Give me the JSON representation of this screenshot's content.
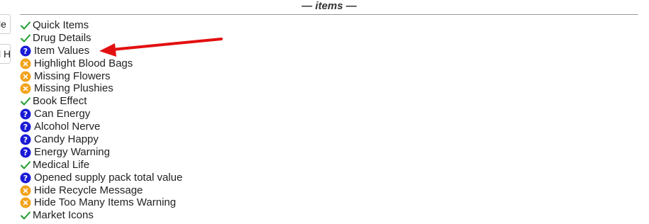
{
  "left_panel": {
    "fragment_1": "le",
    "fragment_2": "l H"
  },
  "section": {
    "title": "— items —"
  },
  "items": [
    {
      "label": "Quick Items",
      "status": "enabled",
      "icon": "check-icon"
    },
    {
      "label": "Drug Details",
      "status": "enabled",
      "icon": "check-icon"
    },
    {
      "label": "Item Values",
      "status": "unknown",
      "icon": "question-icon"
    },
    {
      "label": "Highlight Blood Bags",
      "status": "disabled",
      "icon": "x-circle-icon"
    },
    {
      "label": "Missing Flowers",
      "status": "disabled",
      "icon": "x-circle-icon"
    },
    {
      "label": "Missing Plushies",
      "status": "disabled",
      "icon": "x-circle-icon"
    },
    {
      "label": "Book Effect",
      "status": "enabled",
      "icon": "check-icon"
    },
    {
      "label": "Can Energy",
      "status": "unknown",
      "icon": "question-icon"
    },
    {
      "label": "Alcohol Nerve",
      "status": "unknown",
      "icon": "question-icon"
    },
    {
      "label": "Candy Happy",
      "status": "unknown",
      "icon": "question-icon"
    },
    {
      "label": "Energy Warning",
      "status": "unknown",
      "icon": "question-icon"
    },
    {
      "label": "Medical Life",
      "status": "enabled",
      "icon": "check-icon"
    },
    {
      "label": "Opened supply pack total value",
      "status": "unknown",
      "icon": "question-icon"
    },
    {
      "label": "Hide Recycle Message",
      "status": "disabled",
      "icon": "x-circle-icon"
    },
    {
      "label": "Hide Too Many Items Warning",
      "status": "disabled",
      "icon": "x-circle-icon"
    },
    {
      "label": "Market Icons",
      "status": "enabled",
      "icon": "check-icon"
    }
  ],
  "colors": {
    "check": "#1f9d2f",
    "question": "#1a1ad6",
    "x_circle": "#f2a21b",
    "arrow": "#e21010"
  },
  "annotation": {
    "points_to": "Item Values",
    "icon": "red-arrow-icon"
  }
}
